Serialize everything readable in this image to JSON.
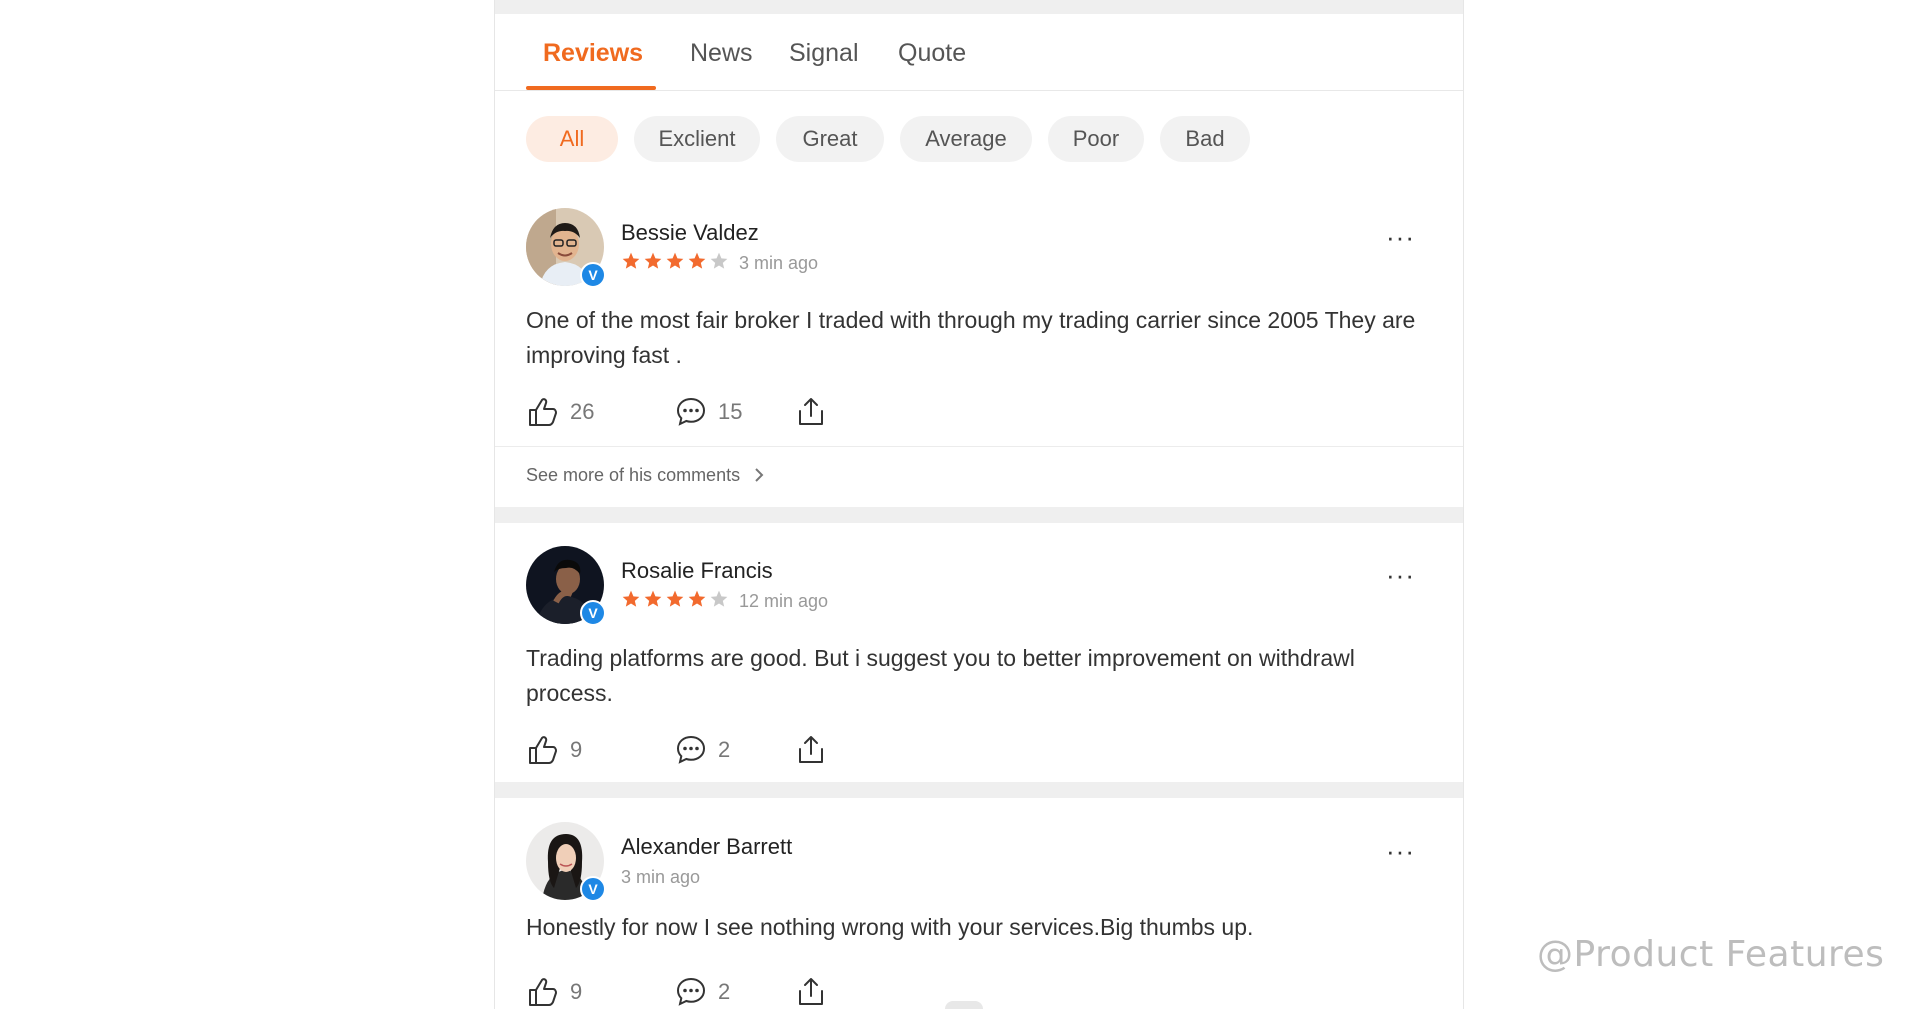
{
  "tabs": [
    {
      "label": "Reviews",
      "active": true
    },
    {
      "label": "News",
      "active": false
    },
    {
      "label": "Signal",
      "active": false
    },
    {
      "label": "Quote",
      "active": false
    }
  ],
  "filters": [
    {
      "label": "All",
      "active": true
    },
    {
      "label": "Exclient",
      "active": false
    },
    {
      "label": "Great",
      "active": false
    },
    {
      "label": "Average",
      "active": false
    },
    {
      "label": "Poor",
      "active": false
    },
    {
      "label": "Bad",
      "active": false
    }
  ],
  "reviews": [
    {
      "name": "Bessie Valdez",
      "rating": 4,
      "time": "3 min ago",
      "text": "One of the most fair broker I traded with through my trading carrier since 2005 They are improving fast .",
      "likes": "26",
      "comments": "15",
      "see_more": "See more of his comments"
    },
    {
      "name": "Rosalie Francis",
      "rating": 4,
      "time": "12 min ago",
      "text": "Trading platforms are good. But i suggest you to better improvement on withdrawl process.",
      "likes": "9",
      "comments": "2"
    },
    {
      "name": "Alexander Barrett",
      "time": "3 min ago",
      "text": "Honestly for now I see nothing wrong with your services.Big thumbs up.",
      "likes": "9",
      "comments": "2"
    }
  ],
  "verified_mark": "V",
  "more_glyph": "···",
  "watermark": "@Product Features",
  "colors": {
    "accent": "#f06a1f",
    "star_on": "#f26a2e",
    "star_off": "#c8c8c8",
    "verified": "#1e88e5"
  }
}
